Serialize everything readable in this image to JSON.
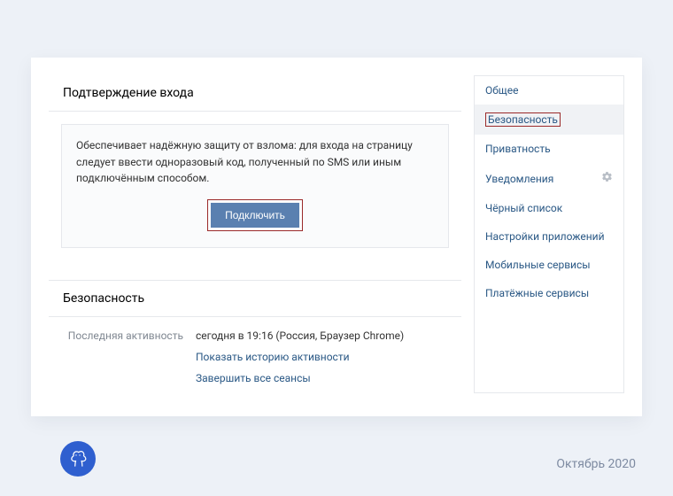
{
  "main": {
    "confirm_title": "Подтверждение входа",
    "info_text": "Обеспечивает надёжную защиту от взлома: для входа на страницу следует ввести одноразовый код, полученный по SMS или иным подключённым способом.",
    "connect_button": "Подключить",
    "security_title": "Безопасность",
    "activity_label": "Последняя активность",
    "activity_value": "сегодня в 19:16 (Россия, Браузер Chrome)",
    "show_history": "Показать историю активности",
    "end_sessions": "Завершить все сеансы"
  },
  "sidebar": {
    "items": [
      {
        "label": "Общее"
      },
      {
        "label": "Безопасность",
        "active": true,
        "highlight": true
      },
      {
        "label": "Приватность"
      },
      {
        "label": "Уведомления",
        "gear": true
      },
      {
        "label": "Чёрный список"
      },
      {
        "label": "Настройки приложений"
      },
      {
        "label": "Мобильные сервисы"
      },
      {
        "label": "Платёжные сервисы"
      }
    ]
  },
  "footer": {
    "date": "Октябрь 2020"
  },
  "accent_color": "#5a80b0",
  "highlight_color": "#9b2b2b"
}
